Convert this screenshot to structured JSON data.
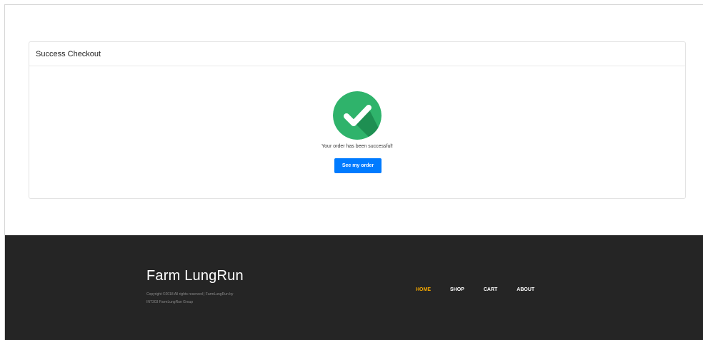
{
  "card": {
    "title": "Success Checkout",
    "message": "Your order has been successful!",
    "button_label": "See my order"
  },
  "footer": {
    "brand": "Farm LungRun",
    "copyright_line1": "Copyright ©2018 All rights reserved | FarmLungRun by",
    "copyright_line2": "INT303 FarmLungRun Group",
    "nav": [
      {
        "label": "HOME",
        "active": true
      },
      {
        "label": "SHOP",
        "active": false
      },
      {
        "label": "CART",
        "active": false
      },
      {
        "label": "ABOUT",
        "active": false
      }
    ]
  },
  "colors": {
    "check_circle": "#2fb36b",
    "check_shadow": "#1e8f52",
    "button": "#007bff",
    "footer_bg": "#252525",
    "active_link": "#f0a500"
  },
  "icons": {
    "success": "check-circle-icon"
  }
}
